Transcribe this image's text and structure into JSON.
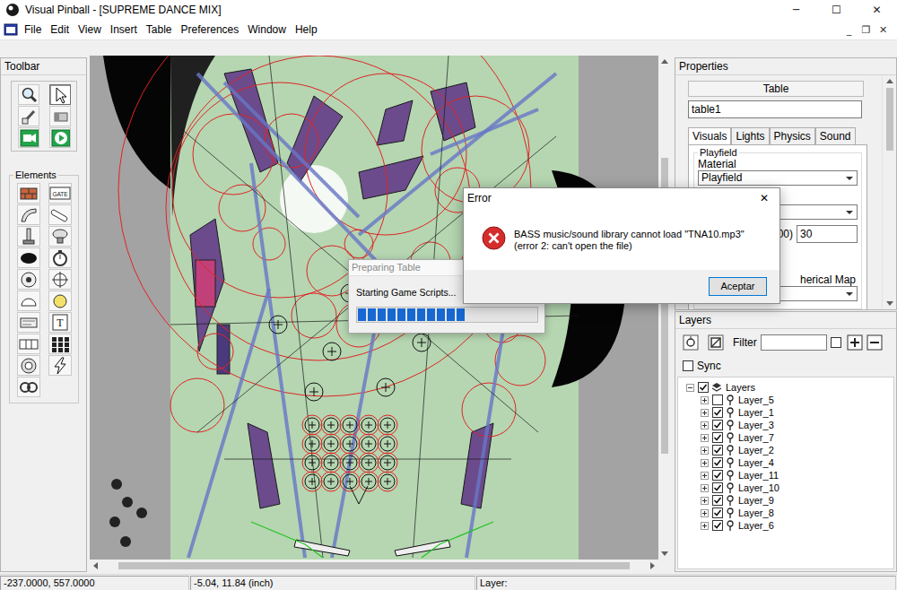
{
  "window": {
    "title": "Visual Pinball - [SUPREME DANCE MIX]",
    "controls": [
      "─",
      "☐",
      "✕"
    ]
  },
  "menu": {
    "items": [
      "File",
      "Edit",
      "View",
      "Insert",
      "Table",
      "Preferences",
      "Window",
      "Help"
    ],
    "mdi_controls": [
      "_",
      "❐",
      "✕"
    ]
  },
  "toolbar": {
    "title": "Toolbar",
    "tools": [
      {
        "selected": false
      },
      {
        "selected": true
      },
      {
        "selected": false
      },
      {
        "selected": false
      },
      {
        "selected": false
      },
      {
        "selected": false
      }
    ]
  },
  "elements": {
    "title": "Elements",
    "gate_label": "GATE",
    "textbox_label": "T"
  },
  "properties": {
    "title": "Properties",
    "object_type": "Table",
    "name": "table1",
    "tabs": [
      {
        "label": "Visuals",
        "selected": true
      },
      {
        "label": "Lights",
        "selected": false
      },
      {
        "label": "Physics",
        "selected": false
      },
      {
        "label": "Sound",
        "selected": false
      }
    ],
    "group": "Playfield",
    "material_label": "Material",
    "material_value": "Playfield",
    "cut_label": "00)",
    "cut_value": "30",
    "cut_label_2": "herical Map"
  },
  "layers": {
    "title": "Layers",
    "filter_label": "Filter",
    "filter_value": "",
    "filter_checked": false,
    "sync": {
      "label": "Sync",
      "checked": false
    },
    "root": {
      "label": "Layers",
      "checked": true,
      "expanded": true
    },
    "items": [
      {
        "label": "Layer_5",
        "checked": false,
        "expanded": false
      },
      {
        "label": "Layer_1",
        "checked": true,
        "expanded": false
      },
      {
        "label": "Layer_3",
        "checked": true,
        "expanded": false
      },
      {
        "label": "Layer_7",
        "checked": true,
        "expanded": false
      },
      {
        "label": "Layer_2",
        "checked": true,
        "expanded": false
      },
      {
        "label": "Layer_4",
        "checked": true,
        "expanded": false
      },
      {
        "label": "Layer_11",
        "checked": true,
        "expanded": false
      },
      {
        "label": "Layer_10",
        "checked": true,
        "expanded": false
      },
      {
        "label": "Layer_9",
        "checked": true,
        "expanded": false
      },
      {
        "label": "Layer_8",
        "checked": true,
        "expanded": false
      },
      {
        "label": "Layer_6",
        "checked": true,
        "expanded": false
      }
    ]
  },
  "progress_dialog": {
    "title": "Preparing Table",
    "message": "Starting Game Scripts...",
    "level": 0.61
  },
  "error_dialog": {
    "title": "Error",
    "close": "✕",
    "message": "BASS music/sound library cannot load \"TNA10.mp3\" (error 2: can't open the file)",
    "button": "Aceptar"
  },
  "status_bar": [
    "-237.0000, 557.0000",
    "-5.04, 11.84 (inch)",
    "Layer:"
  ]
}
